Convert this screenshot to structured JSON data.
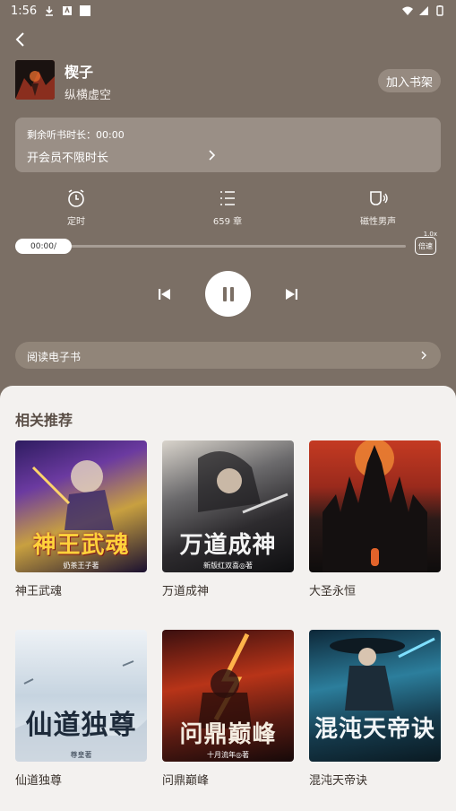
{
  "status_bar": {
    "time": "1:56"
  },
  "book": {
    "title": "楔子",
    "author": "纵横虚空",
    "shelf_button": "加入书架"
  },
  "vip": {
    "remaining_label": "剩余听书时长：00:00",
    "link_label": "开会员不限时长"
  },
  "controls": [
    {
      "label": "定时",
      "icon": "timer-icon"
    },
    {
      "label": "659 章",
      "icon": "chapter-list-icon"
    },
    {
      "label": "磁性男声",
      "icon": "voice-icon"
    }
  ],
  "progress": {
    "time_label": "00:00/",
    "value": 0,
    "speed_label": "倍速",
    "speed_badge": "1.0x"
  },
  "player": {
    "state": "playing"
  },
  "ebook": {
    "label": "阅读电子书"
  },
  "recommend": {
    "title": "相关推荐",
    "books": [
      {
        "name": "神王武魂",
        "cover_title": "神王武魂",
        "cover_sub": "奶茶王子著"
      },
      {
        "name": "万道成神",
        "cover_title": "万道成神",
        "cover_sub": "新版红双喜◎著"
      },
      {
        "name": "大圣永恒",
        "cover_title": "",
        "cover_sub": ""
      },
      {
        "name": "仙道独尊",
        "cover_title": "仙道独尊",
        "cover_sub": "尊皇著"
      },
      {
        "name": "问鼎巅峰",
        "cover_title": "问鼎巅峰",
        "cover_sub": "十月流年◎著"
      },
      {
        "name": "混沌天帝诀",
        "cover_title": "混沌天帝诀",
        "cover_sub": ""
      }
    ]
  },
  "colors": {
    "background": "#7b6f65",
    "panel": "#f3f1ef",
    "accent_text": "#5a4e46"
  }
}
